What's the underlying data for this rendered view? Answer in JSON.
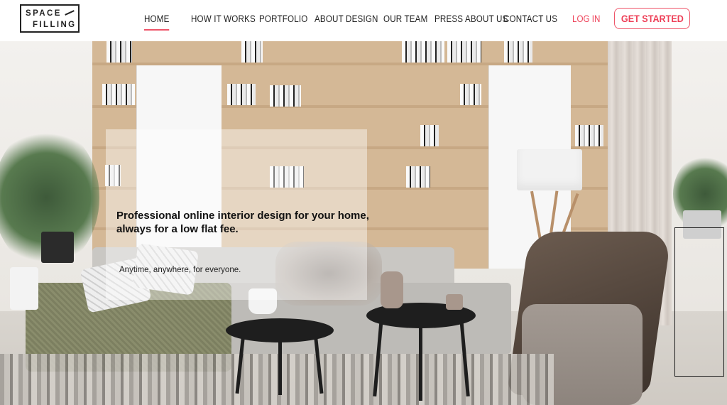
{
  "brand": {
    "line1": "SPACE",
    "line2": "FILLING"
  },
  "nav": {
    "items": [
      {
        "label": "HOME",
        "active": true
      },
      {
        "label": "HOW IT WORKS",
        "active": false
      },
      {
        "label": "PORTFOLIO",
        "active": false
      },
      {
        "label": "ABOUT DESIGN",
        "active": false
      },
      {
        "label": "OUR TEAM",
        "active": false
      },
      {
        "label": "PRESS ABOUT US",
        "active": false
      },
      {
        "label": "CONTACT US",
        "active": false
      }
    ],
    "login_label": "LOG IN",
    "cta_label": "GET STARTED"
  },
  "hero": {
    "tagline": "Professional online interior design for your home, always for a low flat fee.",
    "subline": "Anytime, anywhere, for everyone."
  },
  "colors": {
    "accent": "#ee5569",
    "text": "#222222",
    "background": "#ffffff"
  }
}
